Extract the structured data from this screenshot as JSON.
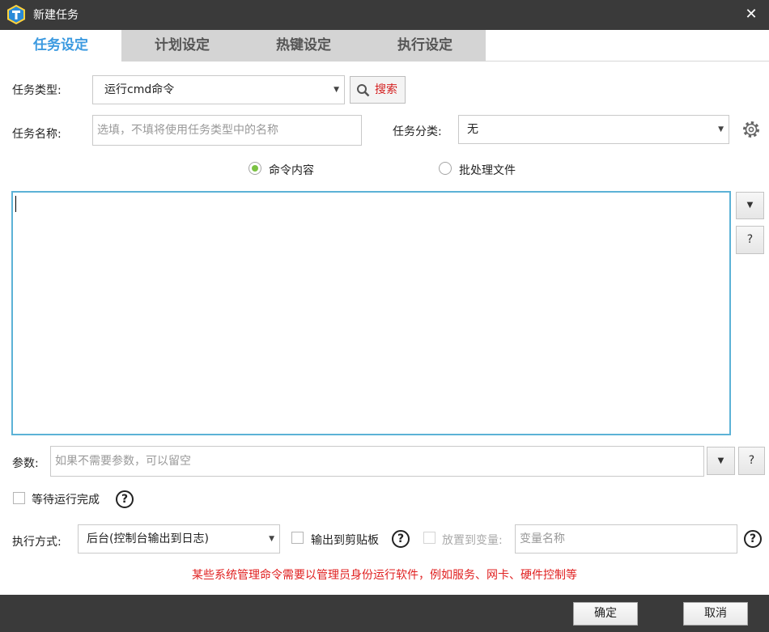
{
  "window": {
    "title": "新建任务",
    "close_glyph": "✕"
  },
  "tabs": [
    {
      "label": "任务设定",
      "active": true
    },
    {
      "label": "计划设定",
      "active": false
    },
    {
      "label": "热键设定",
      "active": false
    },
    {
      "label": "执行设定",
      "active": false
    }
  ],
  "task_type": {
    "label": "任务类型:",
    "value": "运行cmd命令",
    "search_label": "搜索"
  },
  "task_name": {
    "label": "任务名称:",
    "placeholder": "选填，不填将使用任务类型中的名称"
  },
  "task_category": {
    "label": "任务分类:",
    "value": "无"
  },
  "content_mode": {
    "option_command": "命令内容",
    "option_batch": "批处理文件",
    "selected": "命令内容"
  },
  "command_side_buttons": {
    "help_glyph": "?"
  },
  "params": {
    "label": "参数:",
    "placeholder": "如果不需要参数，可以留空",
    "help_glyph": "?"
  },
  "wait_complete": {
    "label": "等待运行完成",
    "checked": false,
    "help_glyph": "?"
  },
  "exec_mode": {
    "label": "执行方式:",
    "value": "后台(控制台输出到日志)",
    "clipboard_label": "输出到剪贴板",
    "variable_label": "放置到变量:",
    "variable_placeholder": "变量名称",
    "help_glyph": "?"
  },
  "warning": "某些系统管理命令需要以管理员身份运行软件，例如服务、网卡、硬件控制等",
  "footer": {
    "ok": "确定",
    "cancel": "取消"
  },
  "colors": {
    "accent": "#3c9ae0",
    "title_bar": "#3a3a3a",
    "warning": "#e02020",
    "search_text": "#d42020",
    "radio_on": "#7bc243"
  },
  "icons": {
    "app": "t-logo-icon",
    "search": "magnifier-icon",
    "settings": "gear-icon",
    "dropdown": "triangle-down-icon"
  }
}
